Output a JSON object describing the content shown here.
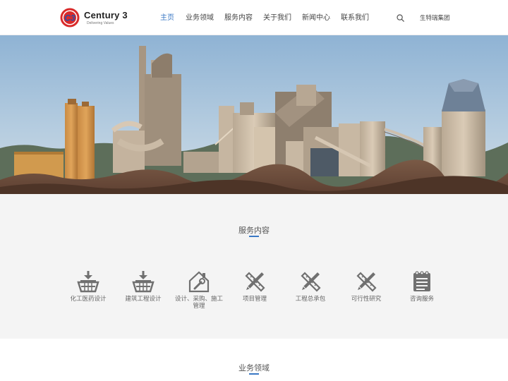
{
  "brand": {
    "name": "Century 3",
    "tagline": "Delivering Values",
    "mark": "C3",
    "colors": {
      "red": "#d92a2a",
      "blue": "#2b4fa8"
    }
  },
  "nav": {
    "items": [
      "主页",
      "业务领域",
      "服务内容",
      "关于我们",
      "新闻中心",
      "联系我们"
    ],
    "active_index": 0
  },
  "header": {
    "search_icon": "search-icon",
    "group_link": "生特瑞集团"
  },
  "hero": {
    "image": "cement-plant-photo"
  },
  "services": {
    "title": "服务内容",
    "items": [
      {
        "label": "化工医药设计",
        "icon": "basket-download-icon"
      },
      {
        "label": "建筑工程设计",
        "icon": "basket-download-icon"
      },
      {
        "label": "设计、采购、施工管理",
        "icon": "house-wrench-icon"
      },
      {
        "label": "项目管理",
        "icon": "pencil-ruler-icon"
      },
      {
        "label": "工程总承包",
        "icon": "pencil-ruler-icon"
      },
      {
        "label": "可行性研究",
        "icon": "pencil-ruler-icon"
      },
      {
        "label": "咨询服务",
        "icon": "notepad-icon"
      }
    ]
  },
  "business": {
    "title": "业务领域"
  },
  "colors": {
    "accent": "#3a78c4",
    "icon_gray": "#707070",
    "section_bg": "#f4f4f4"
  }
}
